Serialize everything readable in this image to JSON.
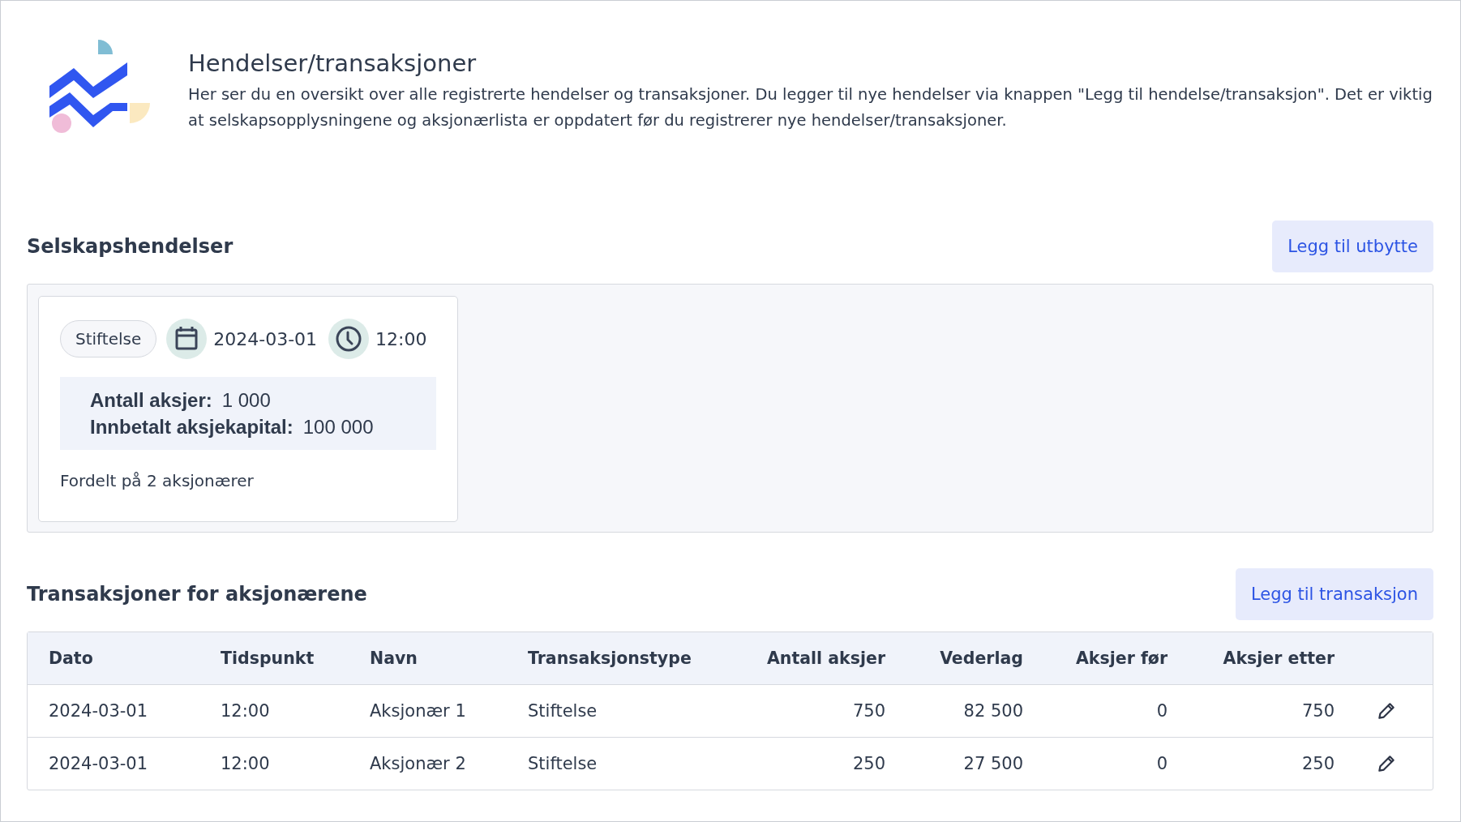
{
  "header": {
    "title": "Hendelser/transaksjoner",
    "description": "Her ser du en oversikt over alle registrerte hendelser og transaksjoner. Du legger til nye hendelser via knappen \"Legg til hendelse/transaksjon\". Det er viktig at selskapsopplysningene og aksjonærlista er oppdatert før du registrerer nye hendelser/transaksjoner."
  },
  "company_events": {
    "title": "Selskapshendelser",
    "button": "Legg til utbytte",
    "events": [
      {
        "tag": "Stiftelse",
        "date": "2024-03-01",
        "time": "12:00",
        "stats": [
          {
            "label": "Antall aksjer:",
            "value": "1 000"
          },
          {
            "label": "Innbetalt aksjekapital:",
            "value": "100 000"
          }
        ],
        "footer": "Fordelt på 2 aksjonærer"
      }
    ]
  },
  "transactions": {
    "title": "Transaksjoner for aksjonærene",
    "button": "Legg til transaksjon",
    "table": {
      "columns": [
        "Dato",
        "Tidspunkt",
        "Navn",
        "Transaksjonstype",
        "Antall aksjer",
        "Vederlag",
        "Aksjer før",
        "Aksjer etter"
      ],
      "rows": [
        [
          "2024-03-01",
          "12:00",
          "Aksjonær 1",
          "Stiftelse",
          "750",
          "82 500",
          "0",
          "750"
        ],
        [
          "2024-03-01",
          "12:00",
          "Aksjonær 2",
          "Stiftelse",
          "250",
          "27 500",
          "0",
          "250"
        ]
      ]
    }
  }
}
